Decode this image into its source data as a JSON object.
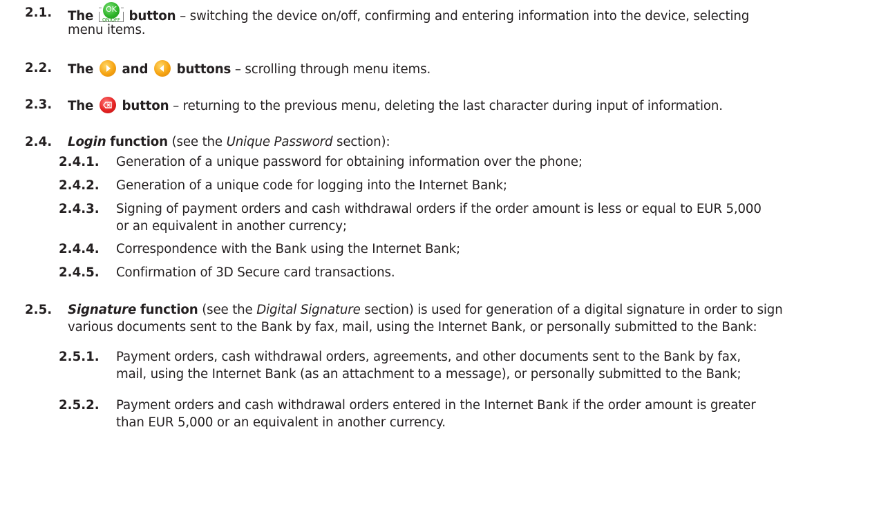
{
  "items": {
    "i21": {
      "num": "2.1.",
      "the": "The",
      "button_label": "button",
      "ok_label": "OK",
      "ok_sub": "ON/OFF",
      "desc_line1": "– switching the device on/off, confirming and entering information into the device, selecting",
      "desc_line2": "menu items."
    },
    "i22": {
      "num": "2.2.",
      "the": "The",
      "and": "and",
      "buttons_label": "buttons",
      "desc": "– scrolling through menu items."
    },
    "i23": {
      "num": "2.3.",
      "the": "The",
      "button_label": "button",
      "desc": "– returning to the previous menu, deleting the last character during input of information."
    },
    "i24": {
      "num": "2.4.",
      "login": "Login",
      "function_label": "function",
      "see_pre": "(see the",
      "section_ref": "Unique Password",
      "see_post": "section):",
      "sub": [
        {
          "num": "2.4.1.",
          "text": "Generation of a unique password for obtaining information over the phone;"
        },
        {
          "num": "2.4.2.",
          "text": "Generation of a unique code for logging into the Internet Bank;"
        },
        {
          "num": "2.4.3.",
          "text": "Signing of payment orders and cash withdrawal orders if the order amount is less or equal to EUR 5,000",
          "text2": "or an equivalent in another currency;"
        },
        {
          "num": "2.4.4.",
          "text": "Correspondence with the Bank using the Internet Bank;"
        },
        {
          "num": "2.4.5.",
          "text": "Confirmation of 3D Secure card transactions."
        }
      ]
    },
    "i25": {
      "num": "2.5.",
      "signature": "Signature",
      "function_label": "function",
      "see_pre": "(see the",
      "section_ref": "Digital Signature",
      "see_post": "section) is used for generation of a digital signature in order to sign",
      "line2": "various documents sent to the Bank by fax, mail, using the Internet Bank, or personally submitted to the Bank:",
      "sub": [
        {
          "num": "2.5.1.",
          "text": "Payment orders, cash withdrawal orders, agreements, and other documents sent to the Bank by fax,",
          "text2": "mail, using the Internet Bank (as an attachment to a message), or personally submitted to the Bank;"
        },
        {
          "num": "2.5.2.",
          "text": "Payment orders and cash withdrawal orders entered in the Internet Bank if the order amount is greater",
          "text2": "than EUR 5,000 or an equivalent in another currency."
        }
      ]
    }
  }
}
